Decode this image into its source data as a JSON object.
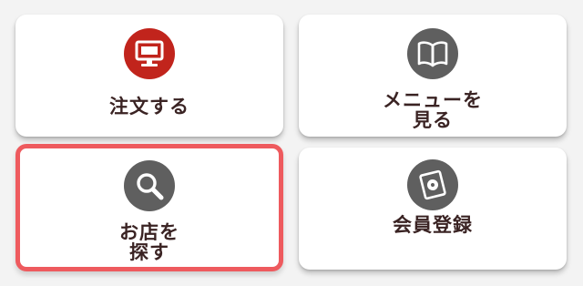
{
  "colors": {
    "accent_red": "#c1241c",
    "icon_gray": "#5f5f5f",
    "selected_border": "#ee5a5e",
    "text": "#3a2323"
  },
  "tiles": {
    "order": {
      "label": "注文する",
      "icon": "monitor-icon"
    },
    "menu": {
      "label_line1": "メニューを",
      "label_line2": "見る",
      "icon": "book-icon"
    },
    "shop": {
      "label_line1": "お店を",
      "label_line2": "探す",
      "icon": "search-icon"
    },
    "register": {
      "label": "会員登録",
      "icon": "card-icon"
    }
  }
}
